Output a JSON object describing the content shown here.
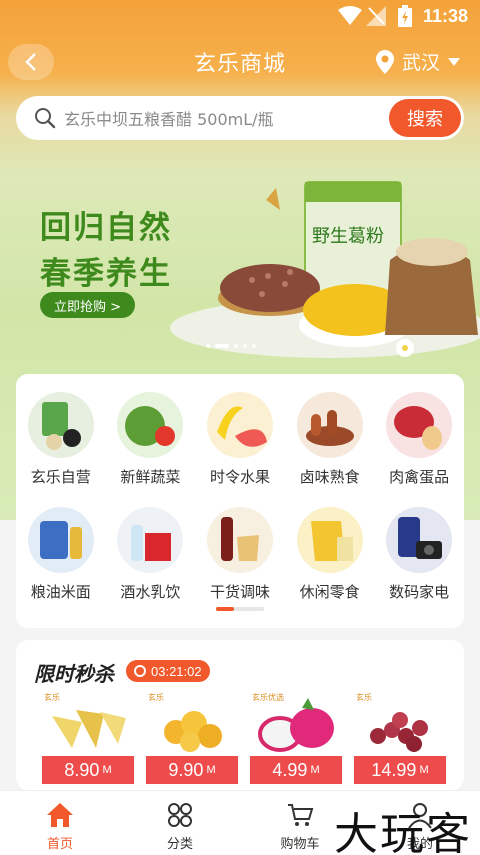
{
  "status_bar": {
    "time": "11:38"
  },
  "header": {
    "title": "玄乐商城",
    "location": "武汉"
  },
  "search": {
    "placeholder": "玄乐中坝五粮香醋 500mL/瓶",
    "button": "搜索"
  },
  "banner": {
    "line1": "回归自然",
    "line2": "春季养生",
    "cta": "立即抢购 >",
    "product_name": "野生葛粉"
  },
  "categories": [
    {
      "label": "玄乐自营",
      "icon": "self-run-icon"
    },
    {
      "label": "新鲜蔬菜",
      "icon": "vegetable-icon"
    },
    {
      "label": "时令水果",
      "icon": "fruit-icon"
    },
    {
      "label": "卤味熟食",
      "icon": "braised-food-icon"
    },
    {
      "label": "肉禽蛋品",
      "icon": "meat-egg-icon"
    },
    {
      "label": "粮油米面",
      "icon": "grain-oil-icon"
    },
    {
      "label": "酒水乳饮",
      "icon": "drinks-icon"
    },
    {
      "label": "干货调味",
      "icon": "seasoning-icon"
    },
    {
      "label": "休闲零食",
      "icon": "snack-icon"
    },
    {
      "label": "数码家电",
      "icon": "electronics-icon"
    }
  ],
  "flash_sale": {
    "title": "限时秒杀",
    "countdown": "03:21:02",
    "currency_mark": "M",
    "products": [
      {
        "price": "8.90",
        "tag": "玄乐"
      },
      {
        "price": "9.90",
        "tag": "玄乐"
      },
      {
        "price": "4.99",
        "tag": "玄乐优选"
      },
      {
        "price": "14.99",
        "tag": "玄乐"
      }
    ]
  },
  "bottom_nav": [
    {
      "label": "首页",
      "active": true
    },
    {
      "label": "分类",
      "active": false
    },
    {
      "label": "购物车",
      "active": false
    },
    {
      "label": "我的",
      "active": false
    }
  ],
  "watermark": "大玩客",
  "colors": {
    "accent": "#f1582b",
    "banner_green": "#3e8a1d",
    "price_red": "#ee4c4c",
    "header_orange": "#f4a23a"
  }
}
